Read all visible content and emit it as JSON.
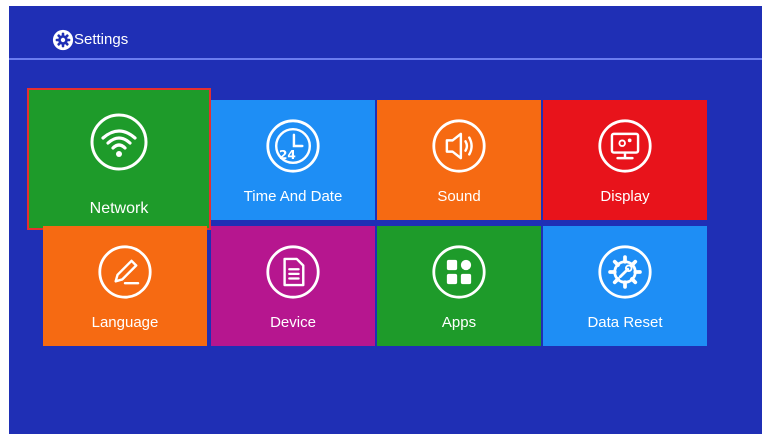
{
  "header": {
    "title": "Settings",
    "icon": "gear-icon"
  },
  "colors": {
    "background": "#1f2fb5",
    "green": "#1e9b2a",
    "blue": "#1e8ef5",
    "orange": "#f66a12",
    "red": "#e8131b",
    "magenta": "#b6168f",
    "focus": "#e53030"
  },
  "tiles": [
    {
      "label": "Network",
      "icon": "wifi-icon",
      "color": "#1e9b2a",
      "focused": true
    },
    {
      "label": "Time And Date",
      "icon": "clock-24-icon",
      "color": "#1e8ef5"
    },
    {
      "label": "Sound",
      "icon": "speaker-icon",
      "color": "#f66a12"
    },
    {
      "label": "Display",
      "icon": "monitor-icon",
      "color": "#e8131b"
    },
    {
      "label": "Language",
      "icon": "pencil-icon",
      "color": "#f66a12"
    },
    {
      "label": "Device",
      "icon": "document-icon",
      "color": "#b6168f"
    },
    {
      "label": "Apps",
      "icon": "apps-grid-icon",
      "color": "#1e9b2a"
    },
    {
      "label": "Data Reset",
      "icon": "gear-wrench-icon",
      "color": "#1e8ef5"
    }
  ]
}
